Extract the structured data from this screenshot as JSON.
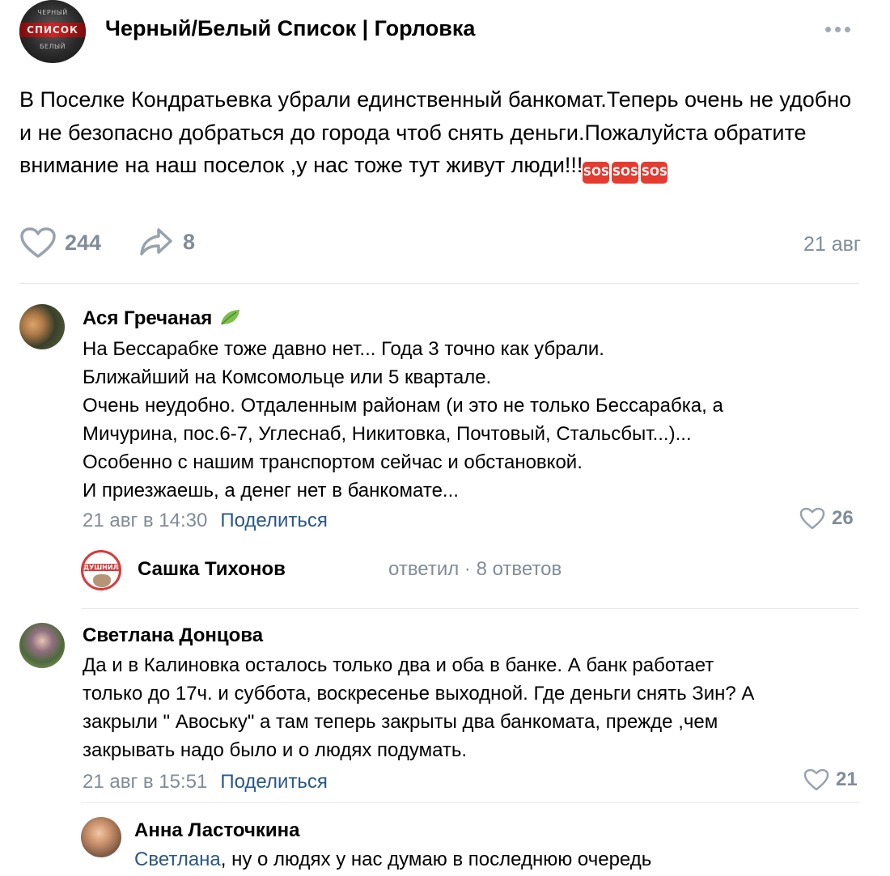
{
  "post": {
    "group_name": "Черный/Белый Список | Горловка",
    "avatar_text": {
      "top": "ЧЕРНЫЙ",
      "middle": "СПИСОК",
      "bottom": "БЕЛЫЙ"
    },
    "text": "В Поселке Кондратьевка убрали единственный банкомат.Теперь очень не удобно и не безопасно добраться до города чтоб снять деньги.Пожалуйста обратите внимание на наш поселок ,у нас тоже тут живут люди!!!",
    "emoji": [
      "SOS",
      "SOS",
      "SOS"
    ],
    "likes": "244",
    "shares": "8",
    "date": "21 авг"
  },
  "comments": [
    {
      "author": "Ася Гречаная",
      "lines": [
        "На Бессарабке тоже давно нет... Года 3 точно как убрали.",
        "Ближайший на Комсомольце или 5 квартале.",
        "Очень неудобно. Отдаленным районам (и это не только Бессарабка, а",
        "Мичурина, пос.6-7, Углеснаб, Никитовка, Почтовый, Стальсбыт...)...",
        "Особенно с нашим транспортом сейчас и обстановкой.",
        "И приезжаешь, а денег нет в банкомате..."
      ],
      "time": "21 авг в 14:30",
      "share_label": "Поделиться",
      "likes": "26",
      "reply_thread": {
        "author": "Сашка Тихонов",
        "avatar_text": "ДУШНИЛА",
        "action": "ответил",
        "separator": "·",
        "count": "8 ответов"
      }
    },
    {
      "author": "Светлана Донцова",
      "lines": [
        "Да и в Калиновка осталось только два и оба в банке. А банк работает",
        "только до 17ч. и суббота, воскресенье выходной. Где деньги снять Зин? А",
        "закрыли \" Авоську\" а там теперь закрыты два банкомата, прежде ,чем",
        "закрывать надо было и о людях подумать."
      ],
      "time": "21 авг в 15:51",
      "share_label": "Поделиться",
      "likes": "21"
    },
    {
      "author": "Анна Ласточкина",
      "mention": "Светлана",
      "text": ", ну о людях у нас думаю в последнюю очередь"
    }
  ],
  "colors": {
    "text": "#000000",
    "secondary": "#818c99",
    "link": "#2a5885",
    "divider": "#e7e8ec",
    "sos": "#e53b30"
  }
}
